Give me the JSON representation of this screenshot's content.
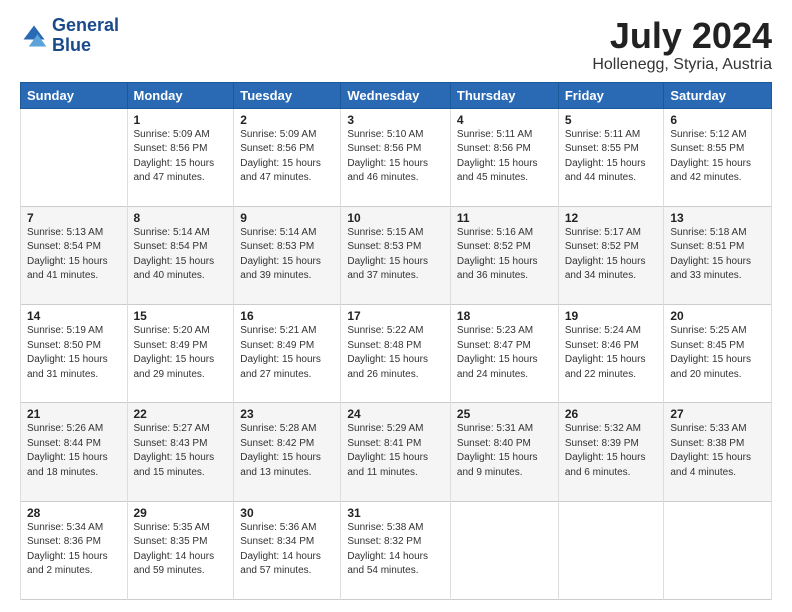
{
  "header": {
    "logo_line1": "General",
    "logo_line2": "Blue",
    "month_title": "July 2024",
    "location": "Hollenegg, Styria, Austria"
  },
  "weekdays": [
    "Sunday",
    "Monday",
    "Tuesday",
    "Wednesday",
    "Thursday",
    "Friday",
    "Saturday"
  ],
  "weeks": [
    [
      {
        "day": "",
        "info": ""
      },
      {
        "day": "1",
        "info": "Sunrise: 5:09 AM\nSunset: 8:56 PM\nDaylight: 15 hours\nand 47 minutes."
      },
      {
        "day": "2",
        "info": "Sunrise: 5:09 AM\nSunset: 8:56 PM\nDaylight: 15 hours\nand 47 minutes."
      },
      {
        "day": "3",
        "info": "Sunrise: 5:10 AM\nSunset: 8:56 PM\nDaylight: 15 hours\nand 46 minutes."
      },
      {
        "day": "4",
        "info": "Sunrise: 5:11 AM\nSunset: 8:56 PM\nDaylight: 15 hours\nand 45 minutes."
      },
      {
        "day": "5",
        "info": "Sunrise: 5:11 AM\nSunset: 8:55 PM\nDaylight: 15 hours\nand 44 minutes."
      },
      {
        "day": "6",
        "info": "Sunrise: 5:12 AM\nSunset: 8:55 PM\nDaylight: 15 hours\nand 42 minutes."
      }
    ],
    [
      {
        "day": "7",
        "info": "Sunrise: 5:13 AM\nSunset: 8:54 PM\nDaylight: 15 hours\nand 41 minutes."
      },
      {
        "day": "8",
        "info": "Sunrise: 5:14 AM\nSunset: 8:54 PM\nDaylight: 15 hours\nand 40 minutes."
      },
      {
        "day": "9",
        "info": "Sunrise: 5:14 AM\nSunset: 8:53 PM\nDaylight: 15 hours\nand 39 minutes."
      },
      {
        "day": "10",
        "info": "Sunrise: 5:15 AM\nSunset: 8:53 PM\nDaylight: 15 hours\nand 37 minutes."
      },
      {
        "day": "11",
        "info": "Sunrise: 5:16 AM\nSunset: 8:52 PM\nDaylight: 15 hours\nand 36 minutes."
      },
      {
        "day": "12",
        "info": "Sunrise: 5:17 AM\nSunset: 8:52 PM\nDaylight: 15 hours\nand 34 minutes."
      },
      {
        "day": "13",
        "info": "Sunrise: 5:18 AM\nSunset: 8:51 PM\nDaylight: 15 hours\nand 33 minutes."
      }
    ],
    [
      {
        "day": "14",
        "info": "Sunrise: 5:19 AM\nSunset: 8:50 PM\nDaylight: 15 hours\nand 31 minutes."
      },
      {
        "day": "15",
        "info": "Sunrise: 5:20 AM\nSunset: 8:49 PM\nDaylight: 15 hours\nand 29 minutes."
      },
      {
        "day": "16",
        "info": "Sunrise: 5:21 AM\nSunset: 8:49 PM\nDaylight: 15 hours\nand 27 minutes."
      },
      {
        "day": "17",
        "info": "Sunrise: 5:22 AM\nSunset: 8:48 PM\nDaylight: 15 hours\nand 26 minutes."
      },
      {
        "day": "18",
        "info": "Sunrise: 5:23 AM\nSunset: 8:47 PM\nDaylight: 15 hours\nand 24 minutes."
      },
      {
        "day": "19",
        "info": "Sunrise: 5:24 AM\nSunset: 8:46 PM\nDaylight: 15 hours\nand 22 minutes."
      },
      {
        "day": "20",
        "info": "Sunrise: 5:25 AM\nSunset: 8:45 PM\nDaylight: 15 hours\nand 20 minutes."
      }
    ],
    [
      {
        "day": "21",
        "info": "Sunrise: 5:26 AM\nSunset: 8:44 PM\nDaylight: 15 hours\nand 18 minutes."
      },
      {
        "day": "22",
        "info": "Sunrise: 5:27 AM\nSunset: 8:43 PM\nDaylight: 15 hours\nand 15 minutes."
      },
      {
        "day": "23",
        "info": "Sunrise: 5:28 AM\nSunset: 8:42 PM\nDaylight: 15 hours\nand 13 minutes."
      },
      {
        "day": "24",
        "info": "Sunrise: 5:29 AM\nSunset: 8:41 PM\nDaylight: 15 hours\nand 11 minutes."
      },
      {
        "day": "25",
        "info": "Sunrise: 5:31 AM\nSunset: 8:40 PM\nDaylight: 15 hours\nand 9 minutes."
      },
      {
        "day": "26",
        "info": "Sunrise: 5:32 AM\nSunset: 8:39 PM\nDaylight: 15 hours\nand 6 minutes."
      },
      {
        "day": "27",
        "info": "Sunrise: 5:33 AM\nSunset: 8:38 PM\nDaylight: 15 hours\nand 4 minutes."
      }
    ],
    [
      {
        "day": "28",
        "info": "Sunrise: 5:34 AM\nSunset: 8:36 PM\nDaylight: 15 hours\nand 2 minutes."
      },
      {
        "day": "29",
        "info": "Sunrise: 5:35 AM\nSunset: 8:35 PM\nDaylight: 14 hours\nand 59 minutes."
      },
      {
        "day": "30",
        "info": "Sunrise: 5:36 AM\nSunset: 8:34 PM\nDaylight: 14 hours\nand 57 minutes."
      },
      {
        "day": "31",
        "info": "Sunrise: 5:38 AM\nSunset: 8:32 PM\nDaylight: 14 hours\nand 54 minutes."
      },
      {
        "day": "",
        "info": ""
      },
      {
        "day": "",
        "info": ""
      },
      {
        "day": "",
        "info": ""
      }
    ]
  ]
}
